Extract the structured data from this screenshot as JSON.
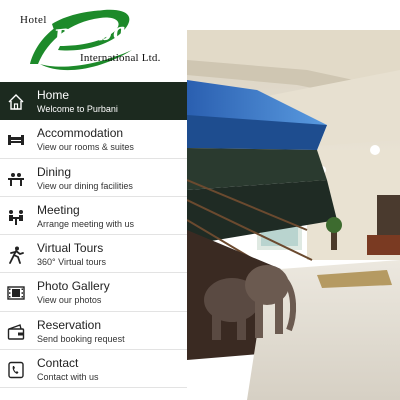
{
  "logo": {
    "hotel": "Hotel",
    "purbani": "Purbani",
    "international": "International Ltd."
  },
  "colors": {
    "logo_green": "#1d8a2a",
    "menu_active_bg": "#1c2a1f"
  },
  "menu": [
    {
      "title": "Home",
      "subtitle": "Welcome to Purbani",
      "icon": "home-icon",
      "active": true
    },
    {
      "title": "Accommodation",
      "subtitle": "View our rooms & suites",
      "icon": "bed-icon",
      "active": false
    },
    {
      "title": "Dining",
      "subtitle": "View our dining facilities",
      "icon": "dining-icon",
      "active": false
    },
    {
      "title": "Meeting",
      "subtitle": "Arrange meeting with us",
      "icon": "meeting-icon",
      "active": false
    },
    {
      "title": "Virtual Tours",
      "subtitle": "360° Virtual tours",
      "icon": "walking-person-icon",
      "active": false
    },
    {
      "title": "Photo Gallery",
      "subtitle": "View our photos",
      "icon": "film-strip-icon",
      "active": false
    },
    {
      "title": "Reservation",
      "subtitle": "Send booking request",
      "icon": "wallet-icon",
      "active": false
    },
    {
      "title": "Contact",
      "subtitle": "Contact with us",
      "icon": "contact-phone-icon",
      "active": false
    }
  ]
}
